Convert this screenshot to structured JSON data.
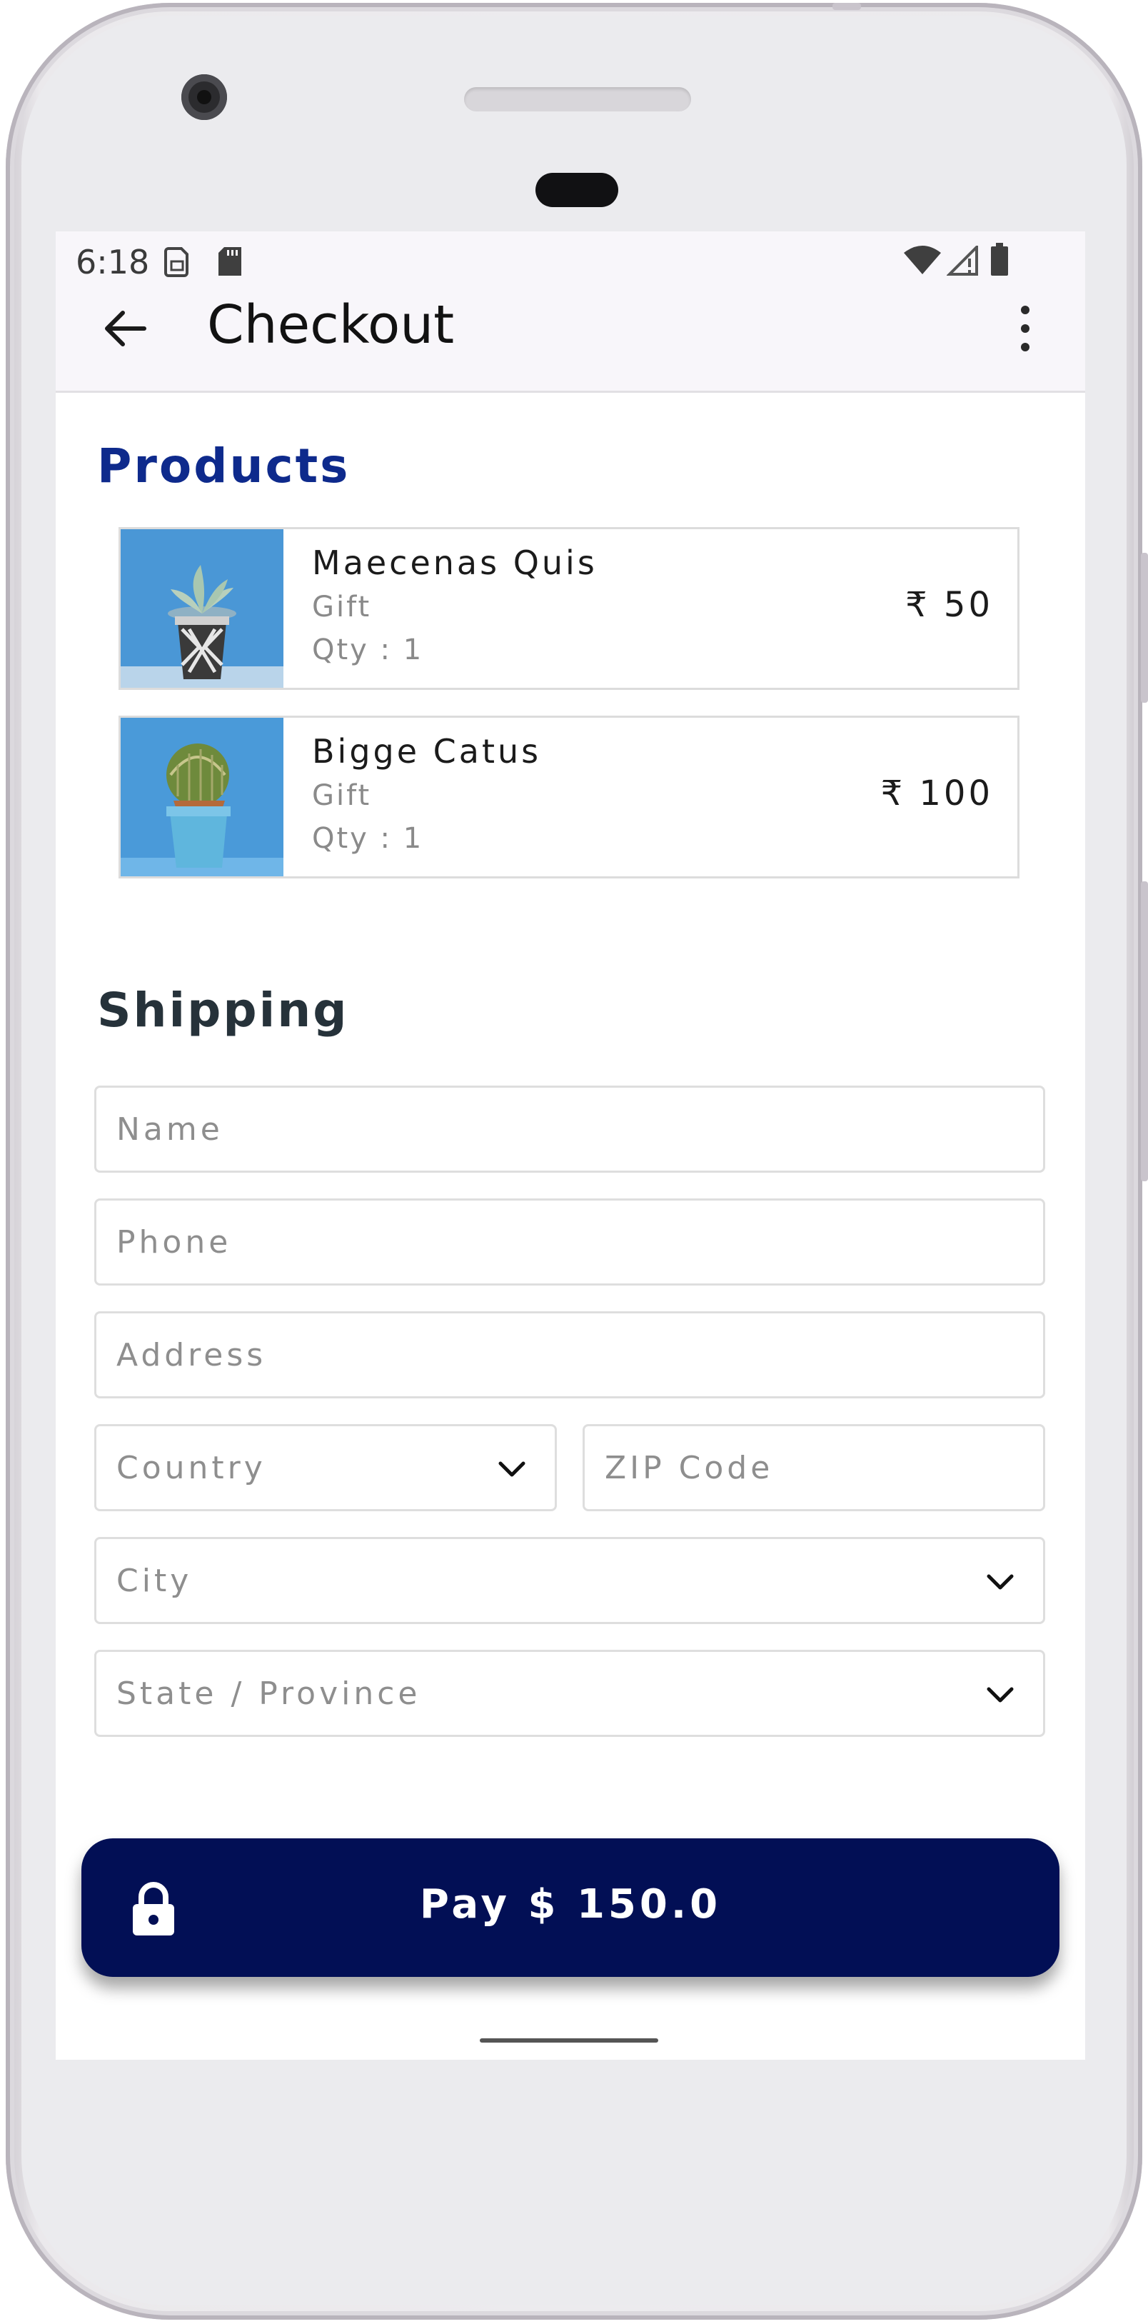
{
  "status_bar": {
    "time": "6:18",
    "left_icons": [
      "sim-icon",
      "sd-card-icon"
    ],
    "right_icons": [
      "wifi-icon",
      "signal-icon",
      "battery-icon"
    ]
  },
  "app_bar": {
    "title": "Checkout",
    "back_icon": "arrow-back-icon",
    "menu_icon": "more-vert-icon"
  },
  "products": {
    "title": "Products",
    "items": [
      {
        "name": "Maecenas Quis",
        "category": "Gift",
        "qty": "Qty : 1",
        "price": "₹ 50"
      },
      {
        "name": "Bigge Catus",
        "category": "Gift",
        "qty": "Qty : 1",
        "price": "₹ 100"
      }
    ]
  },
  "shipping": {
    "title": "Shipping",
    "name_placeholder": "Name",
    "phone_placeholder": "Phone",
    "address_placeholder": "Address",
    "country_placeholder": "Country",
    "zip_placeholder": "ZIP Code",
    "city_placeholder": "City",
    "state_placeholder": "State / Province"
  },
  "pay_button": {
    "label": "Pay $ 150.0",
    "icon": "lock-icon"
  },
  "colors": {
    "primary": "#020f55",
    "products_title": "#0e2a8c",
    "shipping_title": "#26323a",
    "app_bar_bg": "#f8f6fa"
  }
}
